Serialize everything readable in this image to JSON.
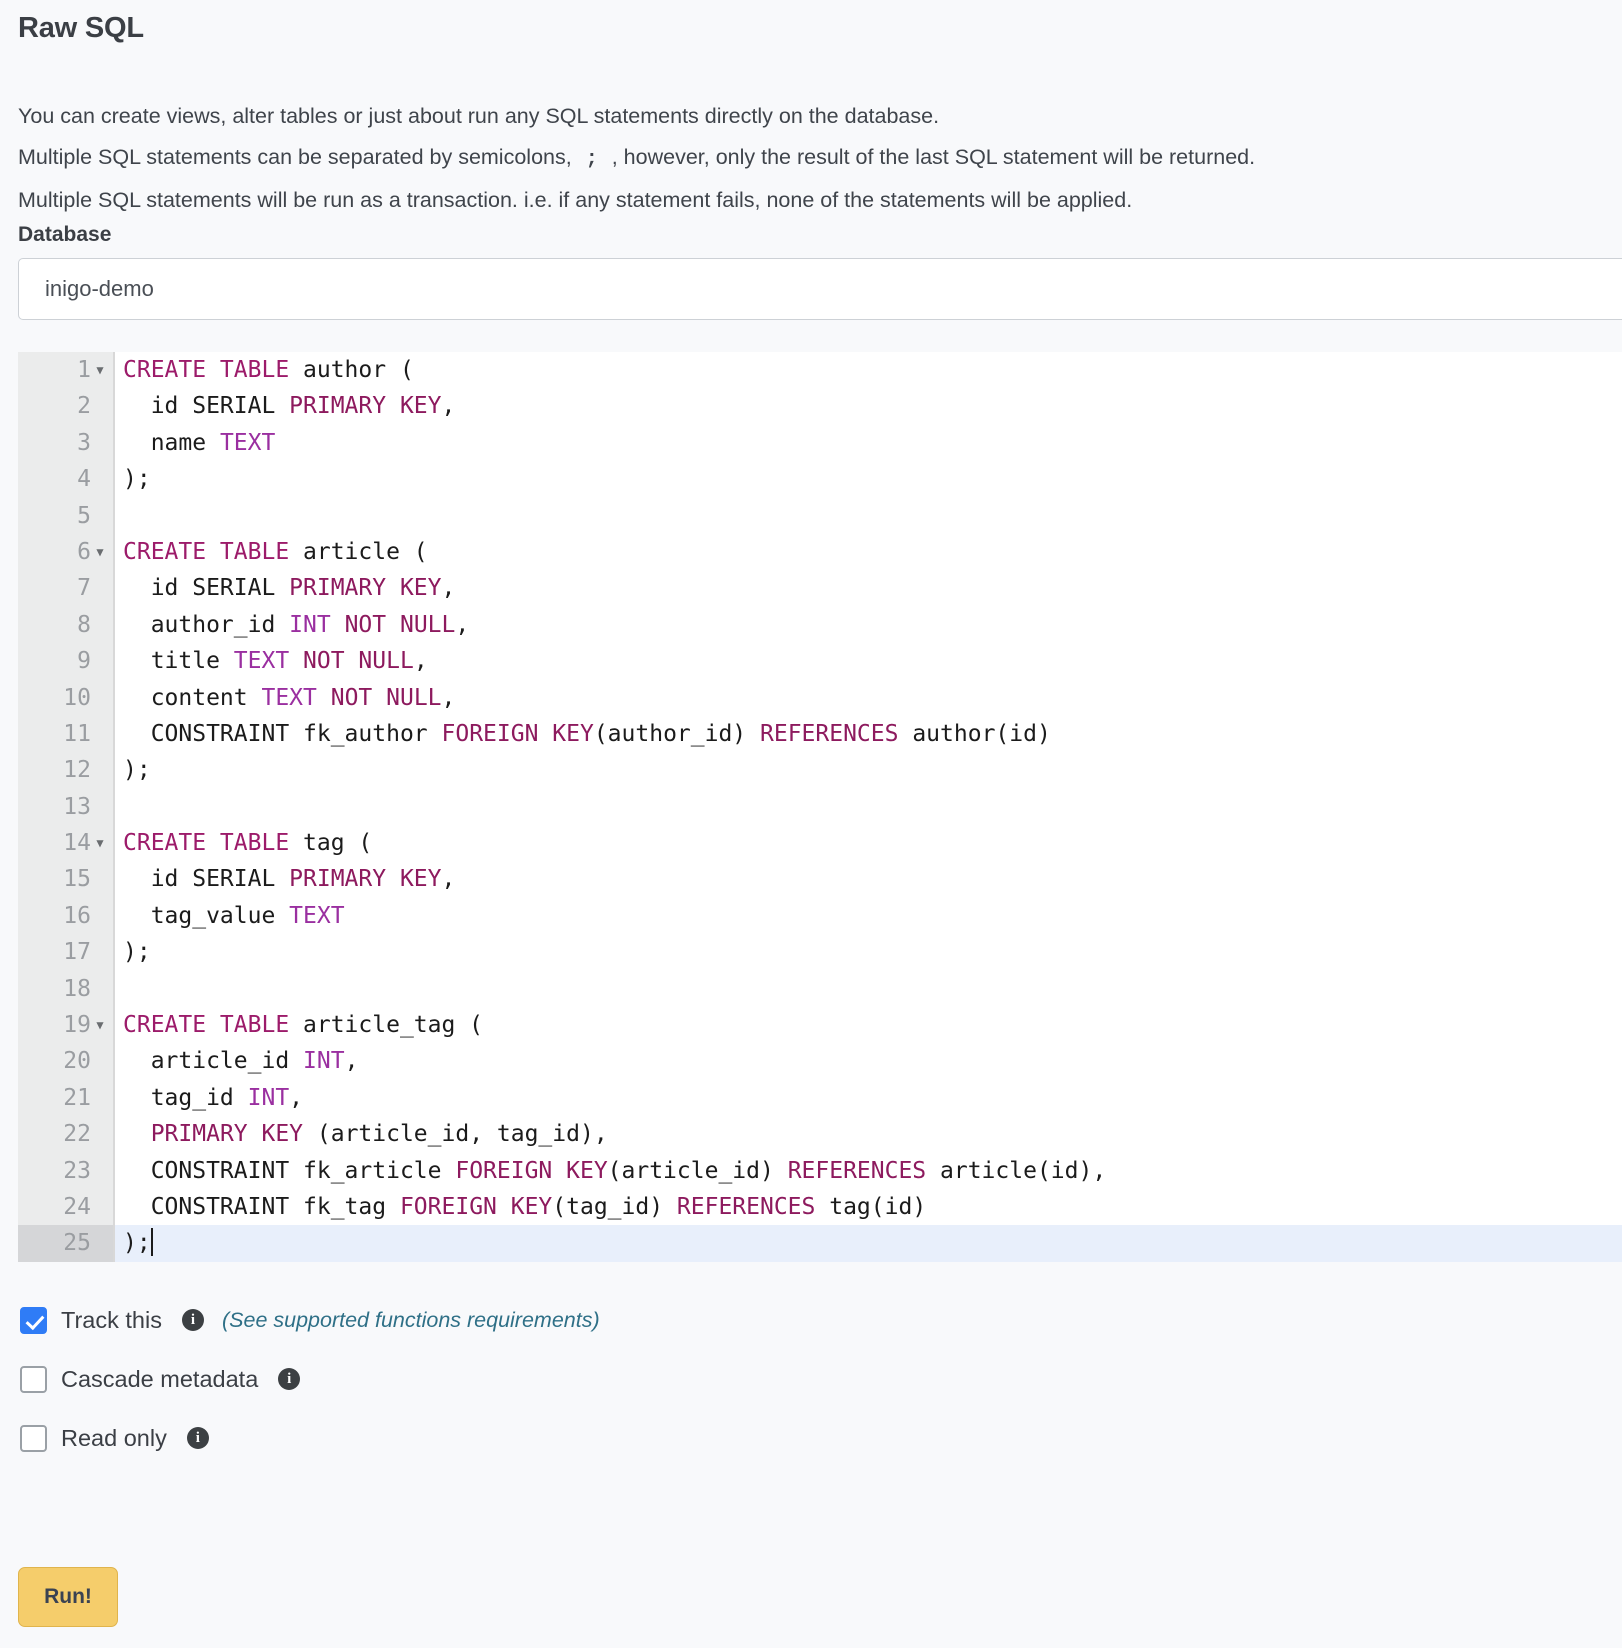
{
  "header": {
    "title": "Raw SQL",
    "description_line1": "You can create views, alter tables or just about run any SQL statements directly on the database.",
    "description_line2_a": "Multiple SQL statements can be separated by semicolons,",
    "description_semicolon": ";",
    "description_line2_b": ", however, only the result of the last SQL statement will be returned.",
    "description_line3": "Multiple SQL statements will be run as a transaction. i.e. if any statement fails, none of the statements will be applied."
  },
  "database": {
    "label": "Database",
    "selected": "inigo-demo"
  },
  "editor": {
    "active_line": 25,
    "colors": {
      "keyword": "#9c1b6a",
      "type": "#9a2fa0",
      "gutter_bg": "#ebecec",
      "active_line_bg": "#e8effb"
    },
    "lines": [
      {
        "n": 1,
        "fold": true,
        "tokens": [
          {
            "t": "CREATE TABLE",
            "c": "kw"
          },
          {
            "t": " author (",
            "c": ""
          }
        ]
      },
      {
        "n": 2,
        "fold": false,
        "tokens": [
          {
            "t": "  id SERIAL ",
            "c": ""
          },
          {
            "t": "PRIMARY KEY",
            "c": "kw2"
          },
          {
            "t": ",",
            "c": ""
          }
        ]
      },
      {
        "n": 3,
        "fold": false,
        "tokens": [
          {
            "t": "  name ",
            "c": ""
          },
          {
            "t": "TEXT",
            "c": "typ"
          }
        ]
      },
      {
        "n": 4,
        "fold": false,
        "tokens": [
          {
            "t": ");",
            "c": ""
          }
        ]
      },
      {
        "n": 5,
        "fold": false,
        "tokens": [
          {
            "t": "",
            "c": ""
          }
        ]
      },
      {
        "n": 6,
        "fold": true,
        "tokens": [
          {
            "t": "CREATE TABLE",
            "c": "kw"
          },
          {
            "t": " article (",
            "c": ""
          }
        ]
      },
      {
        "n": 7,
        "fold": false,
        "tokens": [
          {
            "t": "  id SERIAL ",
            "c": ""
          },
          {
            "t": "PRIMARY KEY",
            "c": "kw2"
          },
          {
            "t": ",",
            "c": ""
          }
        ]
      },
      {
        "n": 8,
        "fold": false,
        "tokens": [
          {
            "t": "  author_id ",
            "c": ""
          },
          {
            "t": "INT",
            "c": "typ"
          },
          {
            "t": " ",
            "c": ""
          },
          {
            "t": "NOT NULL",
            "c": "kw2"
          },
          {
            "t": ",",
            "c": ""
          }
        ]
      },
      {
        "n": 9,
        "fold": false,
        "tokens": [
          {
            "t": "  title ",
            "c": ""
          },
          {
            "t": "TEXT",
            "c": "typ"
          },
          {
            "t": " ",
            "c": ""
          },
          {
            "t": "NOT NULL",
            "c": "kw2"
          },
          {
            "t": ",",
            "c": ""
          }
        ]
      },
      {
        "n": 10,
        "fold": false,
        "tokens": [
          {
            "t": "  content ",
            "c": ""
          },
          {
            "t": "TEXT",
            "c": "typ"
          },
          {
            "t": " ",
            "c": ""
          },
          {
            "t": "NOT NULL",
            "c": "kw2"
          },
          {
            "t": ",",
            "c": ""
          }
        ]
      },
      {
        "n": 11,
        "fold": false,
        "tokens": [
          {
            "t": "  CONSTRAINT fk_author ",
            "c": ""
          },
          {
            "t": "FOREIGN KEY",
            "c": "kw2"
          },
          {
            "t": "(author_id) ",
            "c": ""
          },
          {
            "t": "REFERENCES",
            "c": "kw2"
          },
          {
            "t": " author(id)",
            "c": ""
          }
        ]
      },
      {
        "n": 12,
        "fold": false,
        "tokens": [
          {
            "t": ");",
            "c": ""
          }
        ]
      },
      {
        "n": 13,
        "fold": false,
        "tokens": [
          {
            "t": "",
            "c": ""
          }
        ]
      },
      {
        "n": 14,
        "fold": true,
        "tokens": [
          {
            "t": "CREATE TABLE",
            "c": "kw"
          },
          {
            "t": " tag (",
            "c": ""
          }
        ]
      },
      {
        "n": 15,
        "fold": false,
        "tokens": [
          {
            "t": "  id SERIAL ",
            "c": ""
          },
          {
            "t": "PRIMARY KEY",
            "c": "kw2"
          },
          {
            "t": ",",
            "c": ""
          }
        ]
      },
      {
        "n": 16,
        "fold": false,
        "tokens": [
          {
            "t": "  tag_value ",
            "c": ""
          },
          {
            "t": "TEXT",
            "c": "typ"
          }
        ]
      },
      {
        "n": 17,
        "fold": false,
        "tokens": [
          {
            "t": ");",
            "c": ""
          }
        ]
      },
      {
        "n": 18,
        "fold": false,
        "tokens": [
          {
            "t": "",
            "c": ""
          }
        ]
      },
      {
        "n": 19,
        "fold": true,
        "tokens": [
          {
            "t": "CREATE TABLE",
            "c": "kw"
          },
          {
            "t": " article_tag (",
            "c": ""
          }
        ]
      },
      {
        "n": 20,
        "fold": false,
        "tokens": [
          {
            "t": "  article_id ",
            "c": ""
          },
          {
            "t": "INT",
            "c": "typ"
          },
          {
            "t": ",",
            "c": ""
          }
        ]
      },
      {
        "n": 21,
        "fold": false,
        "tokens": [
          {
            "t": "  tag_id ",
            "c": ""
          },
          {
            "t": "INT",
            "c": "typ"
          },
          {
            "t": ",",
            "c": ""
          }
        ]
      },
      {
        "n": 22,
        "fold": false,
        "tokens": [
          {
            "t": "  ",
            "c": ""
          },
          {
            "t": "PRIMARY KEY",
            "c": "kw2"
          },
          {
            "t": " (article_id, tag_id),",
            "c": ""
          }
        ]
      },
      {
        "n": 23,
        "fold": false,
        "tokens": [
          {
            "t": "  CONSTRAINT fk_article ",
            "c": ""
          },
          {
            "t": "FOREIGN KEY",
            "c": "kw2"
          },
          {
            "t": "(article_id) ",
            "c": ""
          },
          {
            "t": "REFERENCES",
            "c": "kw2"
          },
          {
            "t": " article(id),",
            "c": ""
          }
        ]
      },
      {
        "n": 24,
        "fold": false,
        "tokens": [
          {
            "t": "  CONSTRAINT fk_tag ",
            "c": ""
          },
          {
            "t": "FOREIGN KEY",
            "c": "kw2"
          },
          {
            "t": "(tag_id) ",
            "c": ""
          },
          {
            "t": "REFERENCES",
            "c": "kw2"
          },
          {
            "t": " tag(id)",
            "c": ""
          }
        ]
      },
      {
        "n": 25,
        "fold": false,
        "caret": true,
        "tokens": [
          {
            "t": ");",
            "c": ""
          }
        ]
      }
    ]
  },
  "options": {
    "track_this": {
      "label": "Track this",
      "checked": true,
      "hint": "(See supported functions requirements)"
    },
    "cascade_metadata": {
      "label": "Cascade metadata",
      "checked": false
    },
    "read_only": {
      "label": "Read only",
      "checked": false
    },
    "info_icon_glyph": "i"
  },
  "actions": {
    "run_label": "Run!"
  }
}
